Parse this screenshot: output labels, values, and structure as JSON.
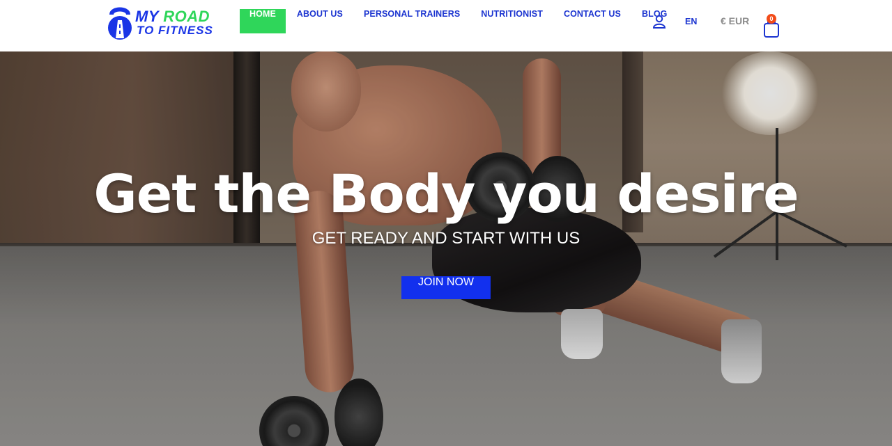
{
  "logo": {
    "line1_a": "MY",
    "line1_b": "ROAD",
    "line2": "TO FITNESS"
  },
  "nav": {
    "items": [
      {
        "label": "HOME",
        "active": true
      },
      {
        "label": "ABOUT US"
      },
      {
        "label": "PERSONAL TRAINERS"
      },
      {
        "label": "NUTRITIONIST"
      },
      {
        "label": "CONTACT US"
      },
      {
        "label": "BLOG"
      }
    ]
  },
  "header": {
    "language": "EN",
    "currency": "€ EUR",
    "cart_count": "0"
  },
  "hero": {
    "title": "Get the Body you desire",
    "subtitle": "GET READY AND START WITH US",
    "cta": "JOIN NOW"
  },
  "colors": {
    "brand_blue": "#1a35e6",
    "brand_green": "#2fd65a",
    "badge": "#f24b19"
  },
  "icons": [
    "kettlebell-logo-icon",
    "user-icon",
    "cart-icon"
  ]
}
